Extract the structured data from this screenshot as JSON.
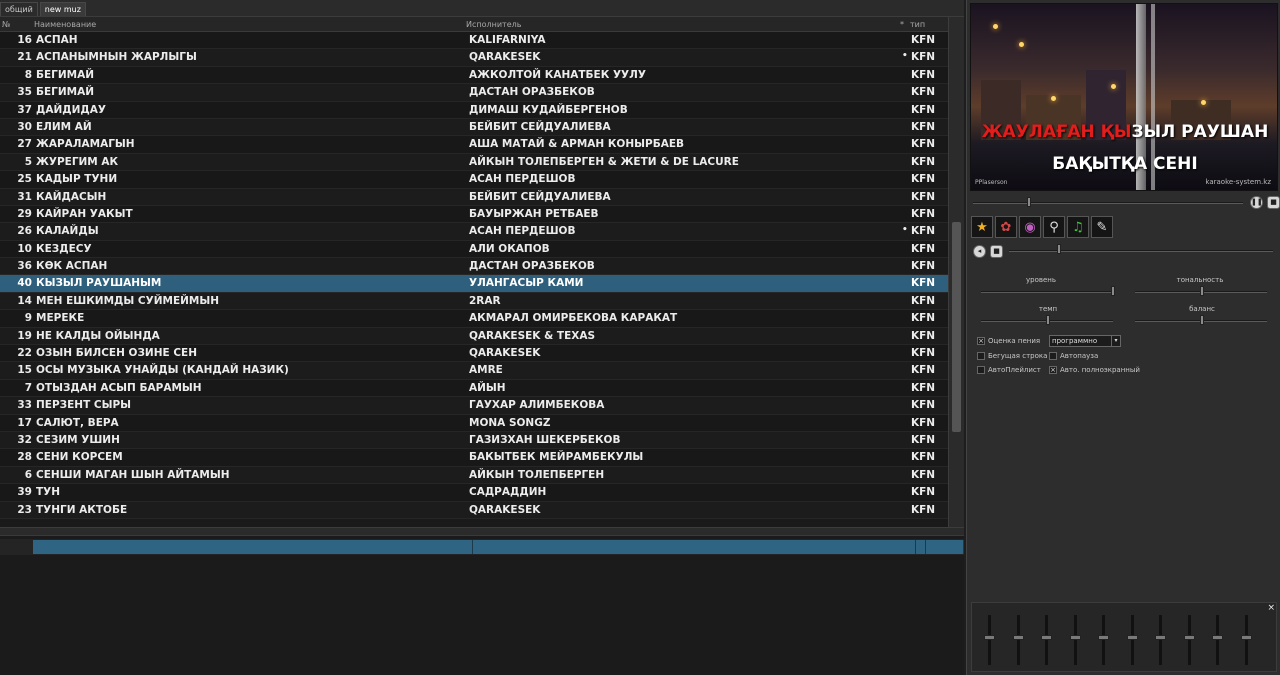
{
  "tabs": [
    {
      "label": "общий",
      "active": false
    },
    {
      "label": "new muz",
      "active": true
    }
  ],
  "columns": {
    "num": "№",
    "name": "Наименование",
    "artist": "Исполнитель",
    "star": "*",
    "type": "тип"
  },
  "songs": [
    {
      "num": "16",
      "name": "АСПАН",
      "artist": "KALIFARNIYA",
      "dot": "",
      "type": "KFN"
    },
    {
      "num": "21",
      "name": "АСПАНЫМНЫН ЖАРЛЫГЫ",
      "artist": "QARAKESEK",
      "dot": "•",
      "type": "KFN"
    },
    {
      "num": "8",
      "name": "БЕГИМАЙ",
      "artist": "АЖКОЛТОЙ КАНАТБЕК УУЛУ",
      "dot": "",
      "type": "KFN"
    },
    {
      "num": "35",
      "name": "БЕГИМАЙ",
      "artist": "ДАСТАН ОРАЗБЕКОВ",
      "dot": "",
      "type": "KFN"
    },
    {
      "num": "37",
      "name": "ДАЙДИДАУ",
      "artist": "ДИМАШ КУДАЙБЕРГЕНОВ",
      "dot": "",
      "type": "KFN"
    },
    {
      "num": "30",
      "name": "ЕЛИМ АЙ",
      "artist": "БЕЙБИТ СЕЙДУАЛИЕВА",
      "dot": "",
      "type": "KFN"
    },
    {
      "num": "27",
      "name": "ЖАРАЛАМАГЫН",
      "artist": "АША МАТАЙ & АРМАН КОНЫРБАЕВ",
      "dot": "",
      "type": "KFN"
    },
    {
      "num": "5",
      "name": "ЖУРЕГИМ АК",
      "artist": "АЙКЫН ТОЛЕПБЕРГЕН & ЖЕТИ & DE LACURE",
      "dot": "",
      "type": "KFN"
    },
    {
      "num": "25",
      "name": "КАДЫР ТУНИ",
      "artist": "АСАН ПЕРДЕШОВ",
      "dot": "",
      "type": "KFN"
    },
    {
      "num": "31",
      "name": "КАЙДАСЫН",
      "artist": "БЕЙБИТ СЕЙДУАЛИЕВА",
      "dot": "",
      "type": "KFN"
    },
    {
      "num": "29",
      "name": "КАЙРАН УАКЫТ",
      "artist": "БАУЫРЖАН РЕТБАЕВ",
      "dot": "",
      "type": "KFN"
    },
    {
      "num": "26",
      "name": "КАЛАЙДЫ",
      "artist": "АСАН ПЕРДЕШОВ",
      "dot": "•",
      "type": "KFN"
    },
    {
      "num": "10",
      "name": "КЕЗДЕСУ",
      "artist": "АЛИ ОКАПОВ",
      "dot": "",
      "type": "KFN"
    },
    {
      "num": "36",
      "name": "КӨК АСПАН",
      "artist": "ДАСТАН ОРАЗБЕКОВ",
      "dot": "",
      "type": "KFN"
    },
    {
      "num": "40",
      "name": "КЫЗЫЛ РАУШАНЫМ",
      "artist": "УЛАНГАСЫР КАМИ",
      "dot": "",
      "type": "KFN",
      "selected": true
    },
    {
      "num": "14",
      "name": "МЕН ЕШКИМДЫ СУЙМЕЙМЫН",
      "artist": "2RAR",
      "dot": "",
      "type": "KFN"
    },
    {
      "num": "9",
      "name": "МЕРЕКЕ",
      "artist": "АКМАРАЛ ОМИРБЕКОВА КАРАКАТ",
      "dot": "",
      "type": "KFN"
    },
    {
      "num": "19",
      "name": "НЕ КАЛДЫ ОЙЫНДА",
      "artist": "QARAKESEK & TEXAS",
      "dot": "",
      "type": "KFN"
    },
    {
      "num": "22",
      "name": "ОЗЫН БИЛСЕН ОЗИНЕ СЕН",
      "artist": "QARAKESEK",
      "dot": "",
      "type": "KFN"
    },
    {
      "num": "15",
      "name": "ОСЫ МУЗЫКА УНАЙДЫ (КАНДАЙ НАЗИК)",
      "artist": "AMRE",
      "dot": "",
      "type": "KFN"
    },
    {
      "num": "7",
      "name": "ОТЫЗДАН АСЫП БАРАМЫН",
      "artist": "АЙЫН",
      "dot": "",
      "type": "KFN"
    },
    {
      "num": "33",
      "name": "ПЕРЗЕНТ СЫРЫ",
      "artist": "ГАУХАР АЛИМБЕКОВА",
      "dot": "",
      "type": "KFN"
    },
    {
      "num": "17",
      "name": "САЛЮТ, ВЕРА",
      "artist": "MONA SONGZ",
      "dot": "",
      "type": "KFN"
    },
    {
      "num": "32",
      "name": "СЕЗИМ УШИН",
      "artist": "ГАЗИЗХАН ШЕКЕРБЕКОВ",
      "dot": "",
      "type": "KFN"
    },
    {
      "num": "28",
      "name": "СЕНИ КОРСЕМ",
      "artist": "БАКЫТБЕК МЕЙРАМБЕКУЛЫ",
      "dot": "",
      "type": "KFN"
    },
    {
      "num": "6",
      "name": "СЕНШИ МАГАН ШЫН АЙТАМЫН",
      "artist": "АЙКЫН ТОЛЕПБЕРГЕН",
      "dot": "",
      "type": "KFN"
    },
    {
      "num": "39",
      "name": "ТУН",
      "artist": "САДРАДДИН",
      "dot": "",
      "type": "KFN"
    },
    {
      "num": "23",
      "name": "ТУНГИ АКТОБЕ",
      "artist": "QARAKESEK",
      "dot": "",
      "type": "KFN"
    }
  ],
  "player": {
    "lyric_line1_sung": "ЖАУЛАҒАН ҚЫ",
    "lyric_line1_rest": "ЗЫЛ РАУШАН",
    "lyric_line2": "БАҚЫТҚА СЕНІ",
    "watermark_left": "PPlaserson",
    "watermark_right": "karaoke-system.kz",
    "progress": 0.2
  },
  "toolbar": [
    {
      "name": "favorite-star-icon",
      "glyph": "★",
      "color": "#f0b020"
    },
    {
      "name": "settings-gear-icon",
      "glyph": "✿",
      "color": "#d04848"
    },
    {
      "name": "record-disc-icon",
      "glyph": "◉",
      "color": "#c060c0"
    },
    {
      "name": "search-magnifier-icon",
      "glyph": "⚲",
      "color": "#e0e0e0"
    },
    {
      "name": "microphone-icon",
      "glyph": "♫",
      "color": "#40c040"
    },
    {
      "name": "edit-pencil-icon",
      "glyph": "✎",
      "color": "#e0e0e0"
    }
  ],
  "controls": {
    "level_label": "уровень",
    "tone_label": "тональность",
    "tempo_label": "темп",
    "balance_label": "баланс",
    "rating_label": "Оценка пения",
    "rating_checked_mark": "×",
    "rating_select_value": "программно",
    "running_line_label": "Бегущая строка",
    "autopause_label": "Автопауза",
    "autoplaylist_label": "АвтоПлейлист",
    "autofullscreen_label": "Авто. полноэкранный",
    "autofullscreen_mark": "×"
  },
  "eq": {
    "close_label": "×",
    "levels": [
      0.55,
      0.55,
      0.55,
      0.55,
      0.55,
      0.55,
      0.55,
      0.55,
      0.55,
      0.55
    ]
  }
}
